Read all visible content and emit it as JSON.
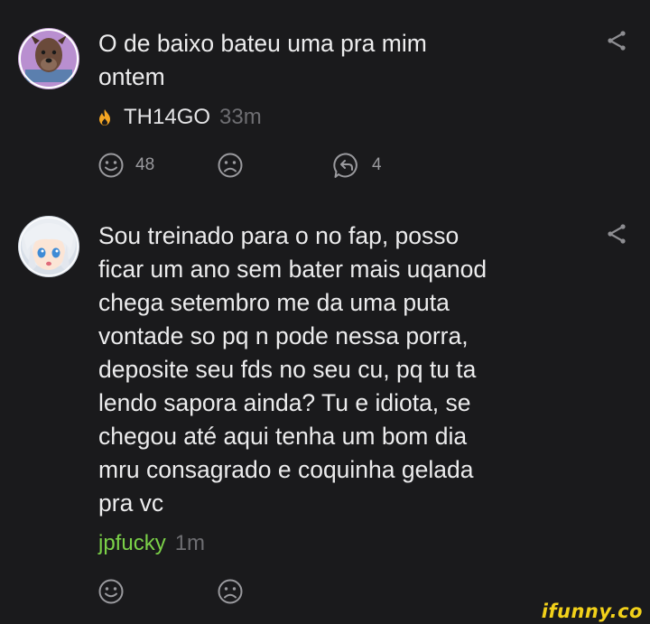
{
  "comments": [
    {
      "avatar": "pitbull-avatar",
      "text_lines": [
        "O de baixo bateu uma pra mim",
        "ontem"
      ],
      "user": "TH14GO",
      "user_badge": "flame-icon",
      "time": "33m",
      "smile_count": "48",
      "reply_count": "4"
    },
    {
      "avatar": "anime-girl-avatar",
      "text_lines": [
        "Sou treinado para o no fap, posso",
        "ficar um ano sem bater mais uqanod",
        "chega setembro me da uma puta",
        "vontade so pq n pode nessa porra,",
        "deposite seu fds no seu cu, pq tu ta",
        "lendo sapora ainda? Tu e idiota, se",
        "chegou até aqui tenha um bom dia",
        "mru consagrado e coquinha gelada",
        "pra vc"
      ],
      "user": "jpfucky",
      "time": "1m"
    }
  ],
  "colors": {
    "background": "#1a1a1c",
    "text": "#ececed",
    "username_green": "#7bd148",
    "flame": "#f5a623",
    "muted": "#6e6e72",
    "icon": "#9a9a9e",
    "watermark": "#f2d11a"
  },
  "watermark": "ifunny.co"
}
